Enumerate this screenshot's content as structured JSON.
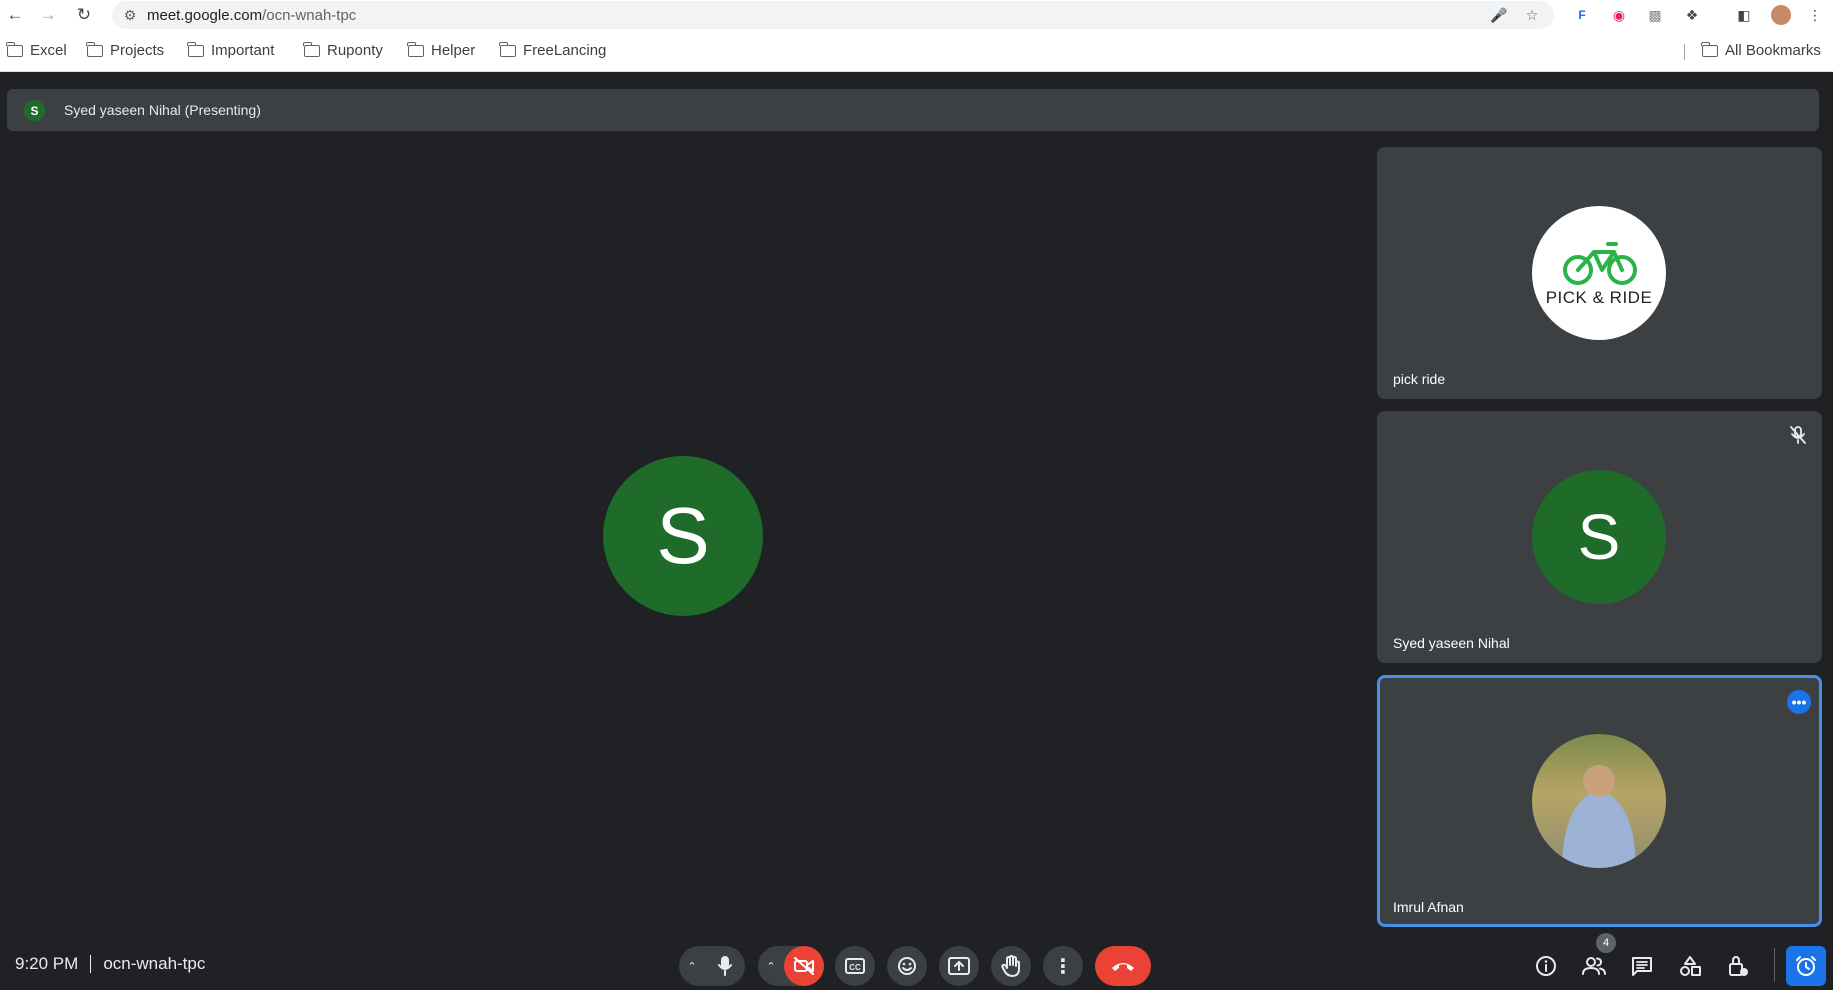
{
  "browser": {
    "url_host": "meet.google.com",
    "url_path": "/ocn-wnah-tpc"
  },
  "bookmarks": {
    "items": [
      {
        "label": "Excel"
      },
      {
        "label": "Projects"
      },
      {
        "label": "Important"
      },
      {
        "label": "Ruponty"
      },
      {
        "label": "Helper"
      },
      {
        "label": "FreeLancing"
      }
    ],
    "all_bookmarks": "All Bookmarks"
  },
  "meeting": {
    "presenter_initial": "S",
    "presenting_label": "Syed yaseen Nihal (Presenting)",
    "main_initial": "S",
    "time": "9:20 PM",
    "code": "ocn-wnah-tpc",
    "participant_count": "4"
  },
  "participants": [
    {
      "name": "pick ride",
      "logo_text": "PICK & RIDE"
    },
    {
      "name": "Syed yaseen Nihal",
      "initial": "S"
    },
    {
      "name": "Imrul Afnan"
    }
  ],
  "colors": {
    "avatar_green": "#1e6b2a",
    "end_call_red": "#ea4335",
    "accent_blue": "#1a73e8"
  }
}
